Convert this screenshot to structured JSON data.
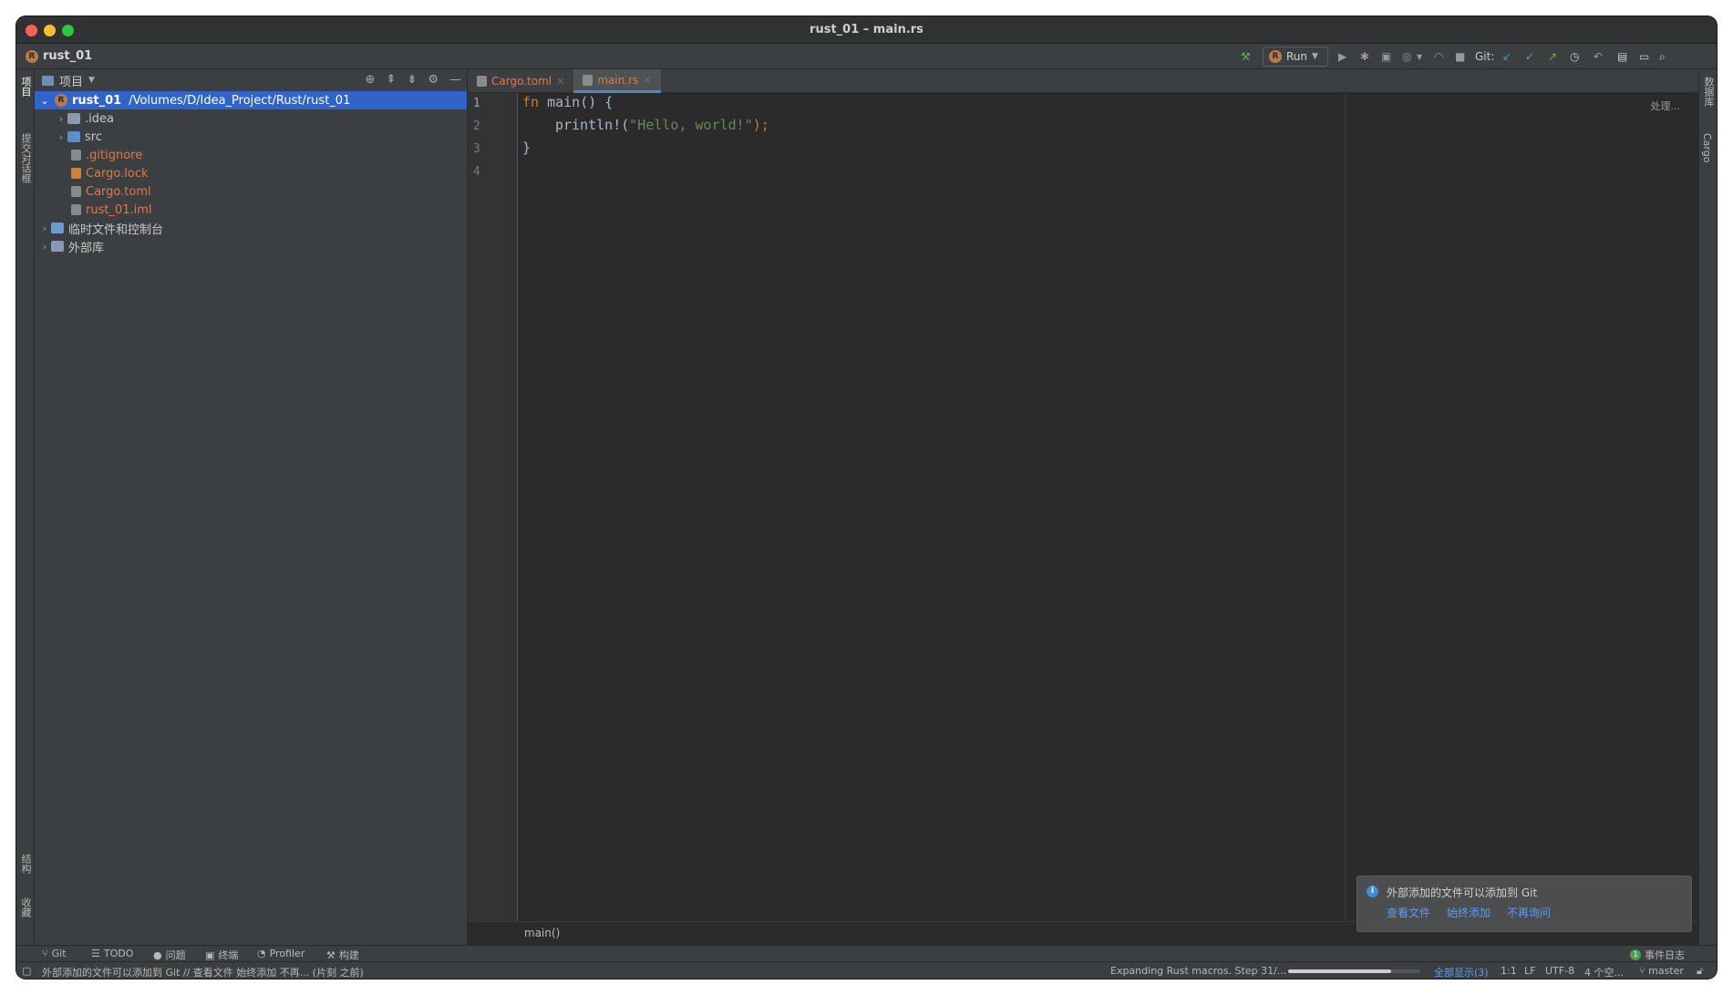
{
  "window": {
    "title": "rust_01 – main.rs"
  },
  "navbar": {
    "project": "rust_01",
    "run_label": "Run",
    "git_label": "Git:"
  },
  "left_strip": {
    "items": [
      "项目",
      "提交对话框",
      "结构",
      "收藏"
    ]
  },
  "right_strip": {
    "items": [
      "数据库",
      "Cargo"
    ]
  },
  "project_panel": {
    "title": "项目",
    "tree": [
      {
        "label": "rust_01",
        "path": "/Volumes/D/Idea_Project/Rust/rust_01"
      },
      {
        "label": ".idea"
      },
      {
        "label": "src"
      },
      {
        "label": ".gitignore"
      },
      {
        "label": "Cargo.lock"
      },
      {
        "label": "Cargo.toml"
      },
      {
        "label": "rust_01.iml"
      },
      {
        "label": "临时文件和控制台"
      },
      {
        "label": "外部库"
      }
    ]
  },
  "editor": {
    "tabs": [
      {
        "label": "Cargo.toml"
      },
      {
        "label": "main.rs"
      }
    ],
    "line_numbers": [
      "1",
      "2",
      "3",
      "4"
    ],
    "code": {
      "l1_kw": "fn",
      "l1_rest": " main() {",
      "l2_macro": "println!(",
      "l2_str": "\"Hello, world!\"",
      "l2_end": ");",
      "l3": "}"
    },
    "processing": "处理...",
    "breadcrumb": "main()"
  },
  "notification": {
    "message": "外部添加的文件可以添加到 Git",
    "links": [
      "查看文件",
      "始终添加",
      "不再询问"
    ]
  },
  "toolwindows": {
    "git": "Git",
    "todo": "TODO",
    "problems": "问题",
    "terminal": "终端",
    "profiler": "Profiler",
    "build": "构建",
    "event_log_count": "1",
    "event_log": "事件日志"
  },
  "statusbar": {
    "message": "外部添加的文件可以添加到 Git // 查看文件   始终添加   不再... (片刻 之前)",
    "macro_progress": "Expanding Rust macros. Step 31/...",
    "progress_fraction": 0.78,
    "show_all": "全部显示(3)",
    "position": "1:1",
    "line_sep": "LF",
    "encoding": "UTF-8",
    "indent": "4 个空...",
    "branch": "master"
  },
  "colors": {
    "selection": "#2f65ca",
    "keyword": "#cc7832",
    "string": "#6a8759",
    "link": "#589df6",
    "modified_file": "#e0774a"
  }
}
